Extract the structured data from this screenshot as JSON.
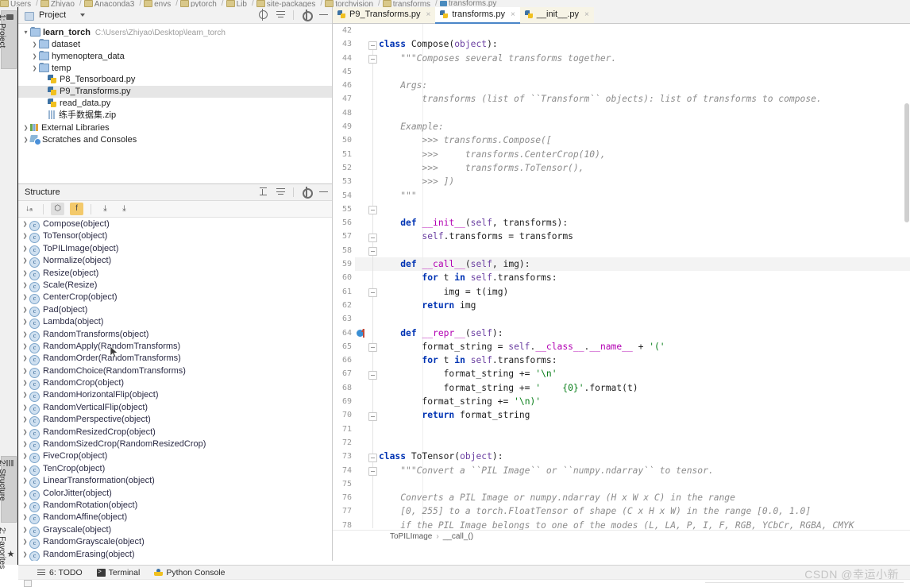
{
  "window": {
    "top_breadcrumb": [
      "Users",
      "Zhiyao",
      "Anaconda3",
      "envs",
      "pytorch",
      "Lib",
      "site-packages",
      "torchvision",
      "transforms",
      "transforms.py"
    ]
  },
  "left_tool_window_bar": {
    "tabs": [
      {
        "label": "1: Project",
        "icon": "folder-icon",
        "active": true
      },
      {
        "label": "2: Structure",
        "icon": "structure-icon",
        "active": true
      },
      {
        "label": "2: Favorites",
        "icon": "star-icon",
        "active": false
      }
    ]
  },
  "project_panel": {
    "title": "Project",
    "icons": [
      "target-icon",
      "collapse-all-icon",
      "gear-icon",
      "minimize-icon"
    ],
    "tree": [
      {
        "indent": 0,
        "arrow": "open",
        "icon": "folder-icon",
        "label": "learn_torch",
        "bold": true,
        "path": "C:\\Users\\Zhiyao\\Desktop\\learn_torch",
        "selected": false
      },
      {
        "indent": 1,
        "arrow": "closed",
        "icon": "folder-icon",
        "label": "dataset",
        "bold": false,
        "path": "",
        "selected": false
      },
      {
        "indent": 1,
        "arrow": "closed",
        "icon": "folder-icon",
        "label": "hymenoptera_data",
        "bold": false,
        "path": "",
        "selected": false
      },
      {
        "indent": 1,
        "arrow": "closed",
        "icon": "folder-icon",
        "label": "temp",
        "bold": false,
        "path": "",
        "selected": false
      },
      {
        "indent": 2,
        "arrow": "none",
        "icon": "python-file-icon",
        "label": "P8_Tensorboard.py",
        "bold": false,
        "path": "",
        "selected": false
      },
      {
        "indent": 2,
        "arrow": "none",
        "icon": "python-file-icon",
        "label": "P9_Transforms.py",
        "bold": false,
        "path": "",
        "selected": true
      },
      {
        "indent": 2,
        "arrow": "none",
        "icon": "python-file-icon",
        "label": "read_data.py",
        "bold": false,
        "path": "",
        "selected": false
      },
      {
        "indent": 2,
        "arrow": "none",
        "icon": "zip-file-icon",
        "label": "练手数据集.zip",
        "bold": false,
        "path": "",
        "selected": false
      },
      {
        "indent": 0,
        "arrow": "closed",
        "icon": "library-icon",
        "label": "External Libraries",
        "bold": false,
        "path": "",
        "selected": false
      },
      {
        "indent": 0,
        "arrow": "closed",
        "icon": "scratches-icon",
        "label": "Scratches and Consoles",
        "bold": false,
        "path": "",
        "selected": false
      }
    ]
  },
  "structure_panel": {
    "title": "Structure",
    "header_icons": [
      "expand-all-icon",
      "collapse-all-icon",
      "gear-icon",
      "minimize-icon"
    ],
    "toolbar": [
      {
        "name": "sort-alphabetically-button",
        "glyph": "↓ₐ",
        "state": "off"
      },
      {
        "name": "show-inherited-button",
        "glyph": "⬡",
        "state": "selected"
      },
      {
        "name": "show-fields-button",
        "glyph": "f",
        "state": "on"
      },
      {
        "name": "expand-all-button",
        "glyph": "⤓",
        "state": "off"
      },
      {
        "name": "collapse-all-button",
        "glyph": "⤓",
        "state": "off"
      }
    ],
    "items": [
      "Compose(object)",
      "ToTensor(object)",
      "ToPILImage(object)",
      "Normalize(object)",
      "Resize(object)",
      "Scale(Resize)",
      "CenterCrop(object)",
      "Pad(object)",
      "Lambda(object)",
      "RandomTransforms(object)",
      "RandomApply(RandomTransforms)",
      "RandomOrder(RandomTransforms)",
      "RandomChoice(RandomTransforms)",
      "RandomCrop(object)",
      "RandomHorizontalFlip(object)",
      "RandomVerticalFlip(object)",
      "RandomPerspective(object)",
      "RandomResizedCrop(object)",
      "RandomSizedCrop(RandomResizedCrop)",
      "FiveCrop(object)",
      "TenCrop(object)",
      "LinearTransformation(object)",
      "ColorJitter(object)",
      "RandomRotation(object)",
      "RandomAffine(object)",
      "Grayscale(object)",
      "RandomGrayscale(object)",
      "RandomErasing(object)"
    ]
  },
  "editor": {
    "tabs": [
      {
        "label": "P9_Transforms.py",
        "active": false,
        "close": "×"
      },
      {
        "label": "transforms.py",
        "active": true,
        "close": "×"
      },
      {
        "label": "__init__.py",
        "active": false,
        "close": "×"
      }
    ],
    "first_line_number": 42,
    "line_numbers": [
      42,
      43,
      44,
      45,
      46,
      47,
      48,
      49,
      50,
      51,
      52,
      53,
      54,
      55,
      56,
      57,
      58,
      59,
      60,
      61,
      62,
      63,
      64,
      65,
      66,
      67,
      68,
      69,
      70,
      71,
      72,
      73,
      74,
      75,
      76,
      77,
      78
    ],
    "breakpoint_line": 64,
    "highlight_line": 59,
    "lines": [
      "",
      "class Compose(object):",
      "    \"\"\"Composes several transforms together.",
      "",
      "    Args:",
      "        transforms (list of ``Transform`` objects): list of transforms to compose.",
      "",
      "    Example:",
      "        >>> transforms.Compose([",
      "        >>>     transforms.CenterCrop(10),",
      "        >>>     transforms.ToTensor(),",
      "        >>> ])",
      "    \"\"\"",
      "",
      "    def __init__(self, transforms):",
      "        self.transforms = transforms",
      "",
      "    def __call__(self, img):",
      "        for t in self.transforms:",
      "            img = t(img)",
      "        return img",
      "",
      "    def __repr__(self):",
      "        format_string = self.__class__.__name__ + '('",
      "        for t in self.transforms:",
      "            format_string += '\\n'",
      "            format_string += '    {0}'.format(t)",
      "        format_string += '\\n)'",
      "        return format_string",
      "",
      "",
      "class ToTensor(object):",
      "    \"\"\"Convert a ``PIL Image`` or ``numpy.ndarray`` to tensor.",
      "",
      "    Converts a PIL Image or numpy.ndarray (H x W x C) in the range",
      "    [0, 255] to a torch.FloatTensor of shape (C x H x W) in the range [0.0, 1.0]",
      "    if the PIL Image belongs to one of the modes (L, LA, P, I, F, RGB, YCbCr, RGBA, CMYK"
    ],
    "breadcrumb": [
      "ToPILImage",
      "__call_()"
    ]
  },
  "status_bar": {
    "items": [
      {
        "label": "6: TODO",
        "icon": "todo-icon"
      },
      {
        "label": "Terminal",
        "icon": "terminal-icon"
      },
      {
        "label": "Python Console",
        "icon": "python-console-icon"
      }
    ]
  },
  "watermark": "CSDN @幸运小新",
  "colors": {
    "accent": "#4a86c8",
    "keyword": "#0033b3",
    "builtin": "#6a3ea1",
    "string": "#067d17",
    "docstring": "#8c8c8c",
    "selection": "#e6e6e6"
  }
}
